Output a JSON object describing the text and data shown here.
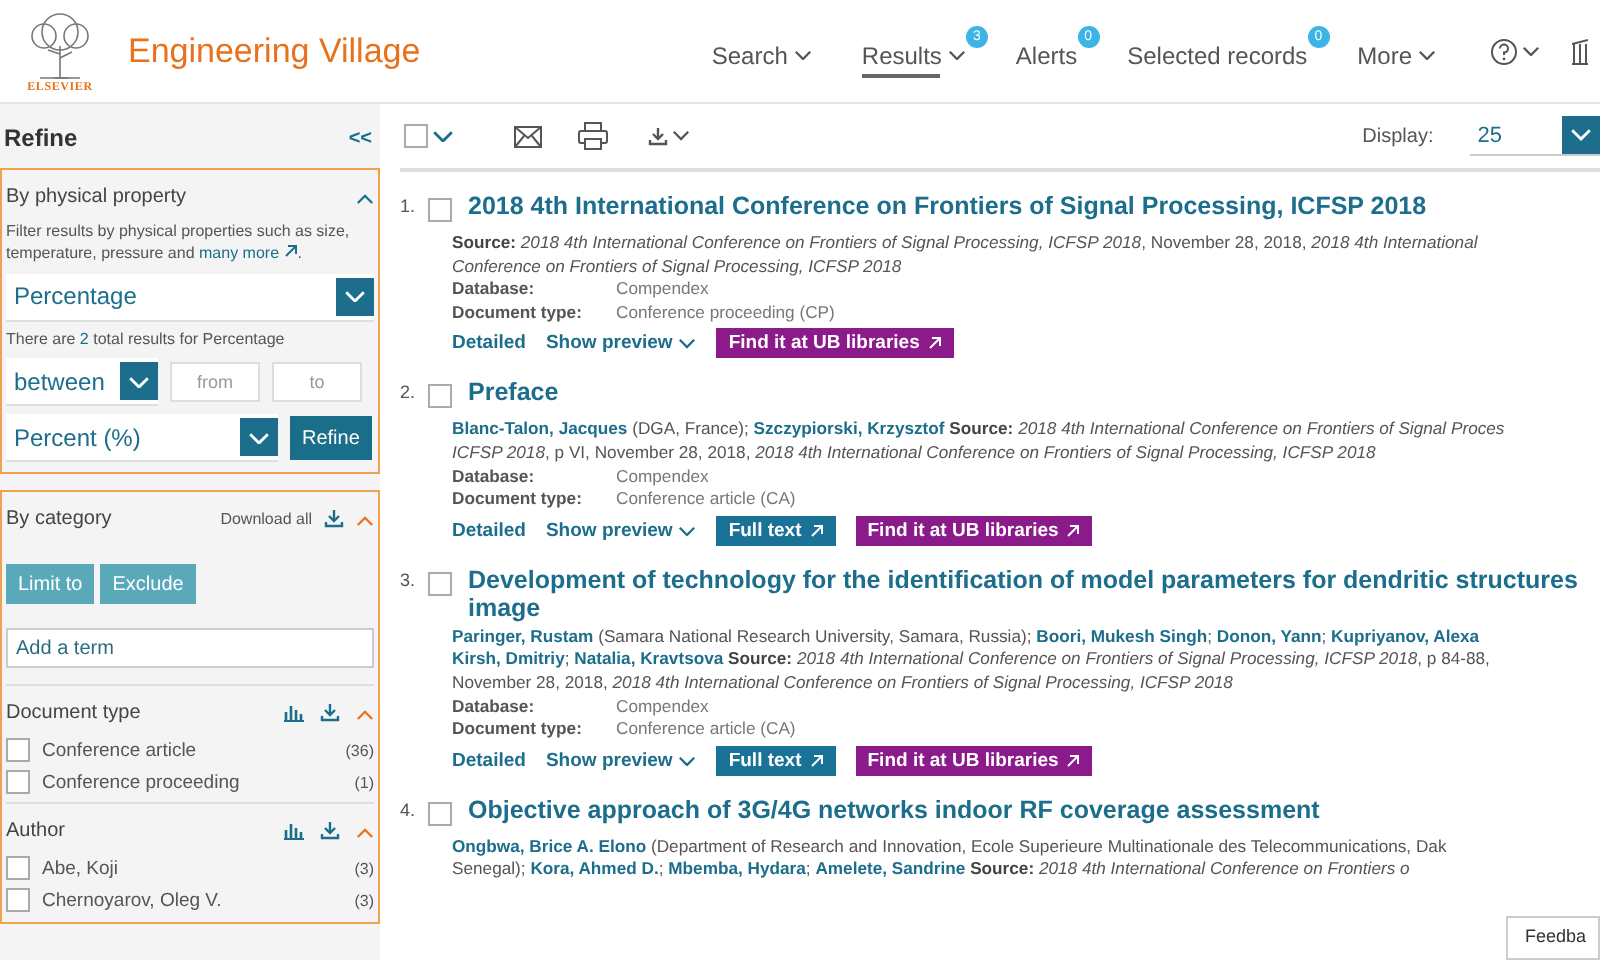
{
  "header": {
    "publisher": "ELSEVIER",
    "brand": "Engineering Village",
    "nav": [
      {
        "label": "Search",
        "selected": false,
        "has_menu": true
      },
      {
        "label": "Results",
        "selected": true,
        "has_menu": true,
        "badge": "3"
      },
      {
        "label": "Alerts",
        "selected": false,
        "has_menu": false,
        "badge": "0"
      },
      {
        "label": "Selected records",
        "selected": false,
        "has_menu": false,
        "badge": "0"
      },
      {
        "label": "More",
        "selected": false,
        "has_menu": true
      }
    ]
  },
  "refine": {
    "title": "Refine",
    "collapse": "<<",
    "physical": {
      "title": "By physical property",
      "expanded": true,
      "description": "Filter results by physical properties such as size, temperature, pressure and",
      "link": "many more",
      "link_suffix": ".",
      "property": "Percentage",
      "count_prefix": "There are",
      "count": "2",
      "count_suffix": "total results for Percentage",
      "operator": "between",
      "from_placeholder": "from",
      "to_placeholder": "to",
      "unit": "Percent (%)",
      "button": "Refine"
    },
    "category": {
      "title": "By category",
      "download": "Download all",
      "expanded": true,
      "buttons": [
        "Limit to",
        "Exclude"
      ],
      "term_placeholder": "Add a term",
      "facets": [
        {
          "title": "Document type",
          "expanded": true,
          "items": [
            {
              "label": "Conference article",
              "count": "(36)",
              "checked": false
            },
            {
              "label": "Conference proceeding",
              "count": "(1)",
              "checked": false
            }
          ]
        },
        {
          "title": "Author",
          "expanded": true,
          "items": [
            {
              "label": "Abe, Koji",
              "count": "(3)",
              "checked": false
            },
            {
              "label": "Chernoyarov, Oleg V.",
              "count": "(3)",
              "checked": false
            }
          ]
        }
      ]
    }
  },
  "toolbar": {
    "select_all_checked": false,
    "display_label": "Display:",
    "display_value": "25"
  },
  "results": [
    {
      "number": "1.",
      "checked": false,
      "title": "2018 4th International Conference on Frontiers of Signal Processing, ICFSP 2018",
      "lines": [
        [
          {
            "kind": "label",
            "text": "Source:"
          },
          {
            "kind": "italic",
            "text": "2018 4th International Conference on Frontiers of Signal Processing, ICFSP 2018"
          },
          {
            "kind": "text",
            "text": ", November 28, 2018,"
          },
          {
            "kind": "italic",
            "text": "2018 4th International"
          }
        ],
        [
          {
            "kind": "italic",
            "text": "Conference on Frontiers of Signal Processing, ICFSP 2018"
          }
        ]
      ],
      "database": {
        "label": "Database:",
        "value": "Compendex"
      },
      "doc_type": {
        "label": "Document type:",
        "value": "Conference proceeding (CP)"
      },
      "actions": [
        {
          "kind": "link",
          "label": "Detailed"
        },
        {
          "kind": "dropdown",
          "label": "Show preview"
        },
        {
          "kind": "library",
          "label": "Find it at UB libraries"
        }
      ]
    },
    {
      "number": "2.",
      "checked": false,
      "title": "Preface",
      "lines": [
        [
          {
            "kind": "author",
            "text": "Blanc-Talon, Jacques"
          },
          {
            "kind": "text",
            "text": "(DGA, France);"
          },
          {
            "kind": "author",
            "text": "Szczypiorski, Krzysztof"
          },
          {
            "kind": "label",
            "text": "Source:"
          },
          {
            "kind": "italic",
            "text": "2018 4th International Conference on Frontiers of Signal Proces"
          }
        ],
        [
          {
            "kind": "italic",
            "text": "ICFSP 2018"
          },
          {
            "kind": "text",
            "text": ", p VI, November 28, 2018,"
          },
          {
            "kind": "italic",
            "text": "2018 4th International Conference on Frontiers of Signal Processing, ICFSP 2018"
          }
        ]
      ],
      "database": {
        "label": "Database:",
        "value": "Compendex"
      },
      "doc_type": {
        "label": "Document type:",
        "value": "Conference article (CA)"
      },
      "actions": [
        {
          "kind": "link",
          "label": "Detailed"
        },
        {
          "kind": "dropdown",
          "label": "Show preview"
        },
        {
          "kind": "fulltext",
          "label": "Full text"
        },
        {
          "kind": "library",
          "label": "Find it at UB libraries"
        }
      ]
    },
    {
      "number": "3.",
      "checked": false,
      "title": "Development of technology for the identification of model parameters for dendritic structures image",
      "lines": [
        [
          {
            "kind": "author",
            "text": "Paringer, Rustam"
          },
          {
            "kind": "text",
            "text": "(Samara National Research University, Samara, Russia);"
          },
          {
            "kind": "author",
            "text": "Boori, Mukesh Singh"
          },
          {
            "kind": "text",
            "text": ";"
          },
          {
            "kind": "author",
            "text": "Donon, Yann"
          },
          {
            "kind": "text",
            "text": ";"
          },
          {
            "kind": "author",
            "text": "Kupriyanov, Alexa"
          }
        ],
        [
          {
            "kind": "author",
            "text": "Kirsh, Dmitriy"
          },
          {
            "kind": "text",
            "text": ";"
          },
          {
            "kind": "author",
            "text": "Natalia, Kravtsova"
          },
          {
            "kind": "label",
            "text": "Source:"
          },
          {
            "kind": "italic",
            "text": "2018 4th International Conference on Frontiers of Signal Processing, ICFSP 2018"
          },
          {
            "kind": "text",
            "text": ", p 84-88,"
          }
        ],
        [
          {
            "kind": "text",
            "text": "November 28, 2018,"
          },
          {
            "kind": "italic",
            "text": "2018 4th International Conference on Frontiers of Signal Processing, ICFSP 2018"
          }
        ]
      ],
      "database": {
        "label": "Database:",
        "value": "Compendex"
      },
      "doc_type": {
        "label": "Document type:",
        "value": "Conference article (CA)"
      },
      "actions": [
        {
          "kind": "link",
          "label": "Detailed"
        },
        {
          "kind": "dropdown",
          "label": "Show preview"
        },
        {
          "kind": "fulltext",
          "label": "Full text"
        },
        {
          "kind": "library",
          "label": "Find it at UB libraries"
        }
      ]
    },
    {
      "number": "4.",
      "checked": false,
      "title": "Objective approach of 3G/4G networks indoor RF coverage assessment",
      "lines": [
        [
          {
            "kind": "author",
            "text": "Ongbwa, Brice A. Elono"
          },
          {
            "kind": "text",
            "text": "(Department of Research and Innovation, Ecole Superieure Multinationale des Telecommunications, Dak"
          }
        ],
        [
          {
            "kind": "text",
            "text": "Senegal);"
          },
          {
            "kind": "author",
            "text": "Kora, Ahmed D."
          },
          {
            "kind": "text",
            "text": ";"
          },
          {
            "kind": "author",
            "text": "Mbemba, Hydara"
          },
          {
            "kind": "text",
            "text": ";"
          },
          {
            "kind": "author",
            "text": "Amelete, Sandrine"
          },
          {
            "kind": "label",
            "text": "Source:"
          },
          {
            "kind": "italic",
            "text": "2018 4th International Conference on Frontiers o"
          }
        ]
      ]
    }
  ],
  "feedback": "Feedba"
}
